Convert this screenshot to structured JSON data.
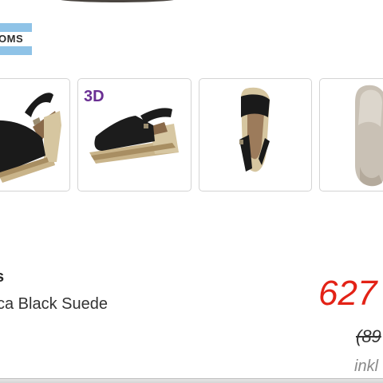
{
  "brand_logo": {
    "text": "OMS"
  },
  "gallery": {
    "badge_3d": "3D"
  },
  "product": {
    "brand": "s",
    "name": "ca Black Suede",
    "price": "627",
    "old_price": "(89",
    "tax_note": "inkl"
  },
  "colors": {
    "accent_price": "#e32216",
    "badge_3d": "#6a2f93",
    "logo_stripe": "#8fc3e7"
  }
}
